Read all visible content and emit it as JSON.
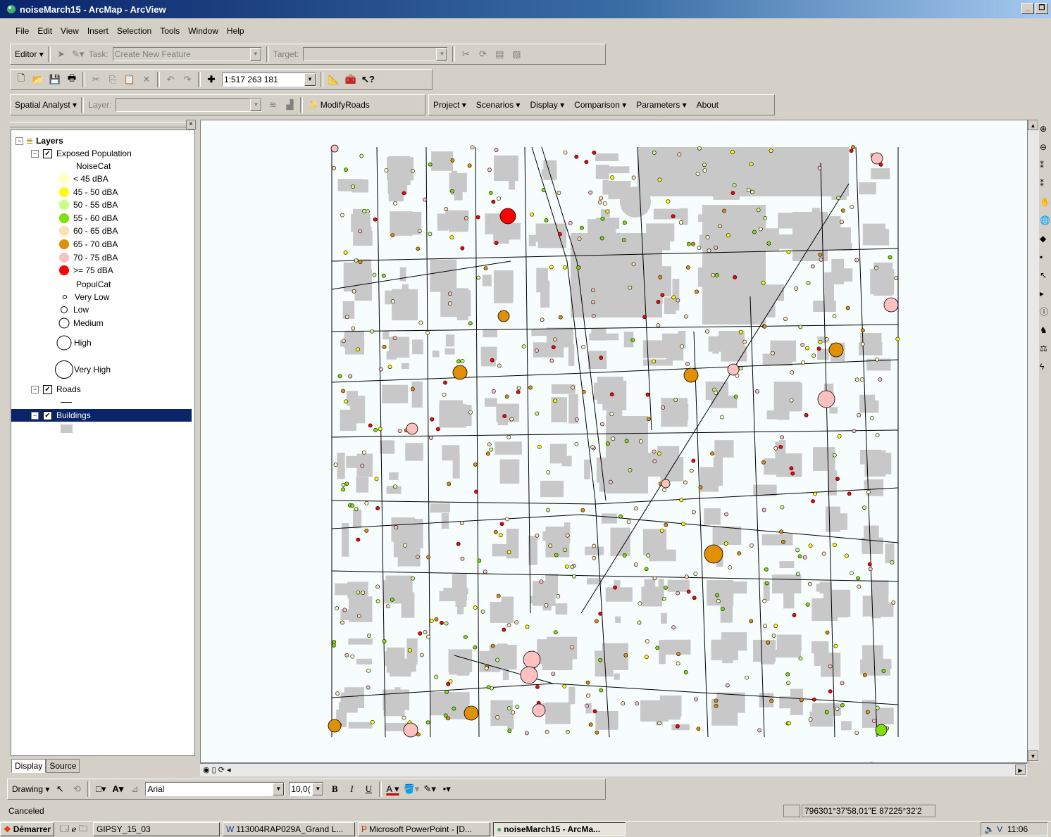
{
  "window": {
    "title": "noiseMarch15 - ArcMap - ArcView"
  },
  "menu": [
    "File",
    "Edit",
    "View",
    "Insert",
    "Selection",
    "Tools",
    "Window",
    "Help"
  ],
  "editor_toolbar": {
    "editor_label": "Editor",
    "task_label": "Task:",
    "task_value": "Create New Feature",
    "target_label": "Target:",
    "target_value": ""
  },
  "standard_toolbar": {
    "scale_value": "1:517 263 181"
  },
  "analyst_toolbar": {
    "spatial_analyst_label": "Spatial Analyst",
    "layer_label": "Layer:",
    "layer_value": "",
    "modify_roads_label": "ModifyRoads",
    "menus": [
      "Project",
      "Scenarios",
      "Display",
      "Comparison",
      "Parameters",
      "About"
    ]
  },
  "toc": {
    "root": "Layers",
    "exposed_population": "Exposed Population",
    "noisecat_heading": "NoiseCat",
    "noise_classes": [
      {
        "label": "< 45 dBA",
        "color": "#ffffc0"
      },
      {
        "label": "45 - 50 dBA",
        "color": "#ffff00"
      },
      {
        "label": "50 - 55 dBA",
        "color": "#c8ff80"
      },
      {
        "label": "55 - 60 dBA",
        "color": "#80e000"
      },
      {
        "label": "60 - 65 dBA",
        "color": "#ffe0b0"
      },
      {
        "label": "65 - 70 dBA",
        "color": "#e09000"
      },
      {
        "label": "70 - 75 dBA",
        "color": "#ffc0c0"
      },
      {
        "label": ">= 75 dBA",
        "color": "#ff0000"
      }
    ],
    "populcat_heading": "PopulCat",
    "popul_classes": [
      "Very Low",
      "Low",
      "Medium",
      "High",
      "Very High"
    ],
    "roads": "Roads",
    "buildings": "Buildings"
  },
  "toc_tabs": {
    "display": "Display",
    "source": "Source"
  },
  "drawing_toolbar": {
    "drawing_label": "Drawing",
    "font_value": "Arial",
    "size_value": "10,0("
  },
  "status": {
    "message": "Canceled",
    "coords": "796301°37'58,01\"E 87225°32'2"
  },
  "taskbar": {
    "start": "Démarrer",
    "tasks": [
      "GIPSY_15_03",
      "113004RAP029A_Grand L...",
      "Microsoft PowerPoint - [D...",
      "noiseMarch15 - ArcMa..."
    ],
    "clock": "11:06"
  },
  "colors": {
    "selection": "#0a246a",
    "building": "#c8c8c8",
    "road": "#000000",
    "map_bg": "#f7fdfd"
  }
}
